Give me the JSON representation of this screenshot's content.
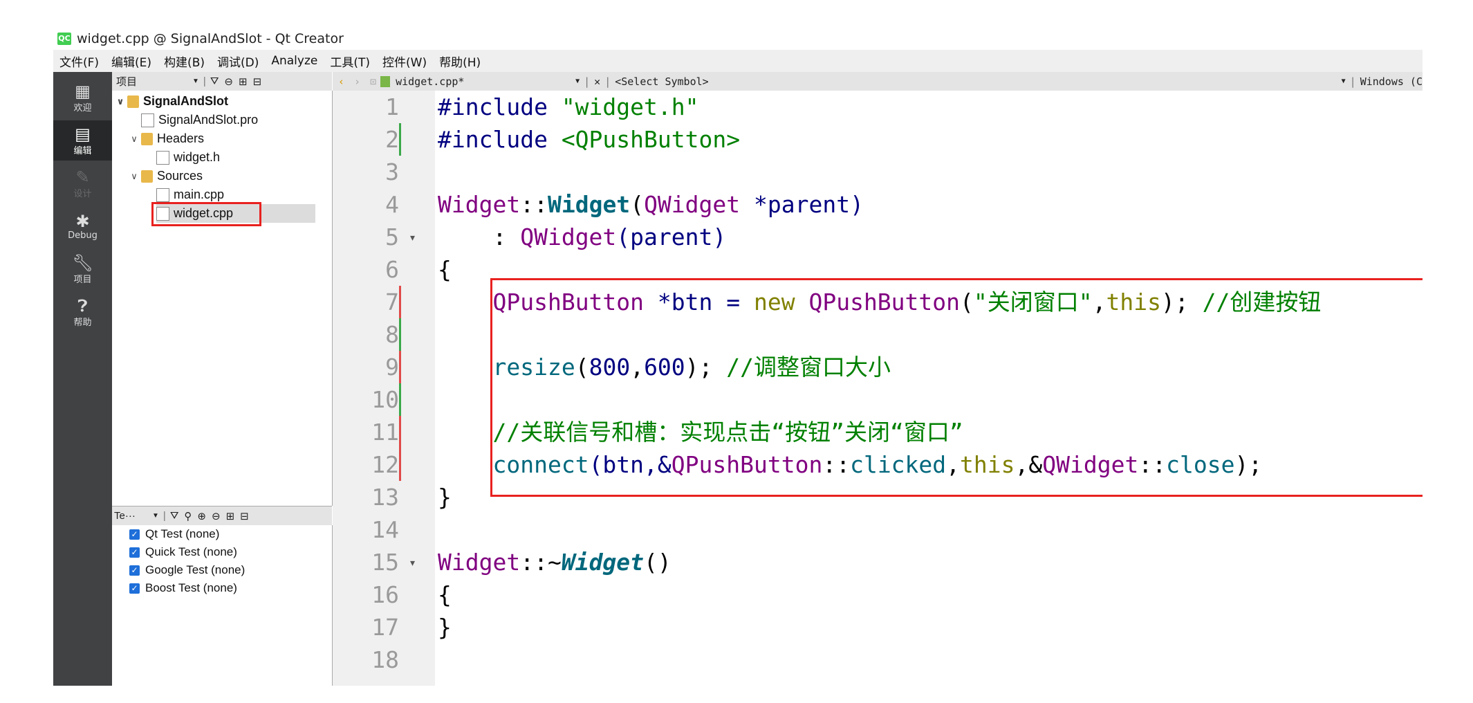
{
  "window": {
    "title": "widget.cpp @ SignalAndSlot - Qt Creator",
    "logo": "QC"
  },
  "menu": [
    "文件(F)",
    "编辑(E)",
    "构建(B)",
    "调试(D)",
    "Analyze",
    "工具(T)",
    "控件(W)",
    "帮助(H)"
  ],
  "modes": [
    {
      "label": "欢迎",
      "icon": "grid-icon"
    },
    {
      "label": "编辑",
      "icon": "edit-icon"
    },
    {
      "label": "设计",
      "icon": "pencil-icon"
    },
    {
      "label": "Debug",
      "icon": "bug-icon"
    },
    {
      "label": "项目",
      "icon": "wrench-icon"
    },
    {
      "label": "帮助",
      "icon": "help-icon"
    }
  ],
  "project_panel": {
    "selector": "项目",
    "tree": [
      {
        "label": "SignalAndSlot",
        "type": "project"
      },
      {
        "label": "SignalAndSlot.pro",
        "type": "pro"
      },
      {
        "label": "Headers",
        "type": "folder"
      },
      {
        "label": "widget.h",
        "type": "h"
      },
      {
        "label": "Sources",
        "type": "folder"
      },
      {
        "label": "main.cpp",
        "type": "cpp"
      },
      {
        "label": "widget.cpp",
        "type": "cpp"
      }
    ]
  },
  "tests_panel": {
    "selector": "Te···",
    "items": [
      "Qt Test (none)",
      "Quick Test (none)",
      "Google Test (none)",
      "Boost Test (none)"
    ]
  },
  "editor_toolbar": {
    "file": "widget.cpp*",
    "symbol": "<Select Symbol>",
    "line_ending": "Windows (C"
  },
  "line_numbers": [
    "1",
    "2",
    "3",
    "4",
    "5",
    "6",
    "7",
    "8",
    "9",
    "10",
    "11",
    "12",
    "13",
    "14",
    "15",
    "16",
    "17",
    "18"
  ],
  "code": {
    "l1": [
      "#include ",
      "\"widget.h\""
    ],
    "l2": [
      "#include ",
      "<QPushButton>"
    ],
    "l4": [
      "Widget",
      "::",
      "Widget",
      "(",
      "QWidget",
      " *parent)"
    ],
    "l5": [
      "    : ",
      "QWidget",
      "(parent)"
    ],
    "l6": "{",
    "l7": [
      "    ",
      "QPushButton",
      " *btn = ",
      "new",
      " ",
      "QPushButton",
      "(",
      "\"关闭窗口\"",
      ",",
      "this",
      "); ",
      "//创建按钮"
    ],
    "l9": [
      "    ",
      "resize",
      "(",
      "800",
      ",",
      "600",
      "); ",
      "//调整窗口大小"
    ],
    "l11": [
      "    ",
      "//关联信号和槽：实现点击“按钮”关闭“窗口”"
    ],
    "l12": [
      "    ",
      "connect",
      "(btn,&",
      "QPushButton",
      "::",
      "clicked",
      ",",
      "this",
      ",&",
      "QWidget",
      "::",
      "close",
      ");"
    ],
    "l13": "}",
    "l15": [
      "Widget",
      "::~",
      "Widget",
      "()"
    ],
    "l16": "{",
    "l17": "}"
  }
}
